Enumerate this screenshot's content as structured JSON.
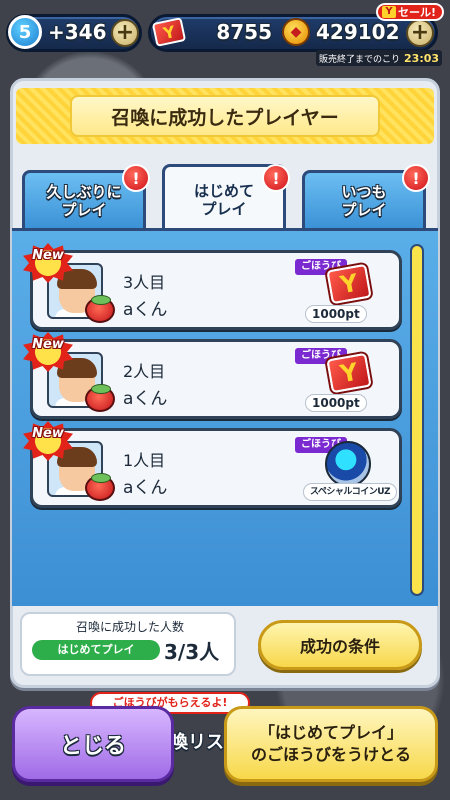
{
  "status_bar": {
    "level": "5",
    "stamina": "+346",
    "ymoney": "8755",
    "money": "429102",
    "sale_badge": "セール!",
    "sale_y": "Y",
    "timer_label": "販売終了までのこり",
    "timer": "23:03"
  },
  "panel": {
    "title": "召喚に成功したプレイヤー",
    "tabs": [
      {
        "line1": "久しぶりに",
        "line2": "プレイ",
        "active": false
      },
      {
        "line1": "はじめて",
        "line2": "プレイ",
        "active": true
      },
      {
        "line1": "いつも",
        "line2": "プレイ",
        "active": false
      }
    ],
    "alert_mark": "!",
    "new_label": "New",
    "reward_tag": "ごほうび",
    "entries": [
      {
        "count": "3人目",
        "name": "aくん",
        "reward": "1000pt"
      },
      {
        "count": "2人目",
        "name": "aくん",
        "reward": "1000pt"
      },
      {
        "count": "1人目",
        "name": "aくん",
        "reward": "スペシャルコインUZ"
      }
    ],
    "summary": {
      "title": "召喚に成功した人数",
      "category": "はじめてプレイ",
      "value": "3/3人"
    },
    "condition_button": "成功の条件"
  },
  "background": {
    "strip_text": "ごほうびがもらえるよ!",
    "partial_text": "喚リス"
  },
  "footer": {
    "close_button": "とじる",
    "receive_line1": "「はじめてプレイ」",
    "receive_line2": "のごほうびをうけとる"
  },
  "colors": {
    "accent_yellow": "#f7d74a",
    "tab_blue": "#3b92d6",
    "close_purple": "#a06be6",
    "alert_red": "#d0101a"
  }
}
